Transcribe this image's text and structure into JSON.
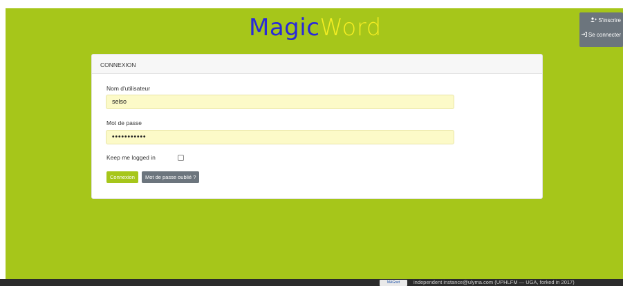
{
  "logo": {
    "part1": "Magic",
    "part2": "Word"
  },
  "usermenu": {
    "register": "S'inscrire",
    "login": "Se connecter"
  },
  "card": {
    "title": "CONNEXION",
    "username_label": "Nom d'utilisateur",
    "username_value": "selso",
    "password_label": "Mot de passe",
    "password_value": "•••••••••••",
    "remember_label": "Keep me logged in",
    "remember_checked": false,
    "login_button": "Connexion",
    "forgot_button": "Mot de passe oublié ?"
  },
  "footer": {
    "badge": "MAGnet",
    "text": "independent instance@ulyma.com (UPHLFM — UGA, forked in 2017)"
  },
  "colors": {
    "background": "#a6c61a",
    "logo_magic": "#2a2ad8",
    "logo_word": "#f4ed23",
    "secondary": "#6c757d"
  }
}
